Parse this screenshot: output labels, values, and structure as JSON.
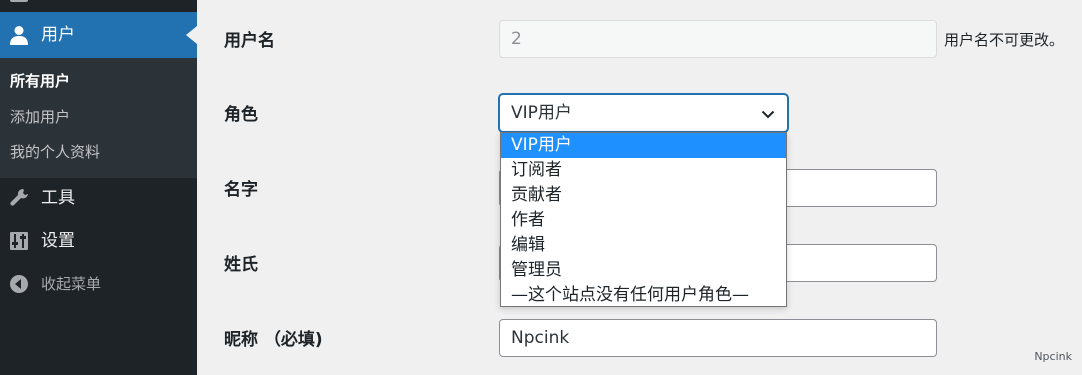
{
  "sidebar": {
    "active": {
      "label": "用户",
      "icon": "user-icon"
    },
    "submenu": [
      {
        "label": "所有用户",
        "current": true
      },
      {
        "label": "添加用户",
        "current": false
      },
      {
        "label": "我的个人资料",
        "current": false
      }
    ],
    "items": [
      {
        "label": "工具",
        "icon": "wrench-icon"
      },
      {
        "label": "设置",
        "icon": "settings-sliders-icon"
      },
      {
        "label": "收起菜单",
        "icon": "collapse-arrow-icon"
      }
    ]
  },
  "form": {
    "username": {
      "label": "用户名",
      "value": "2",
      "note": "用户名不可更改。"
    },
    "role": {
      "label": "角色",
      "selected": "VIP用户",
      "options": [
        "VIP用户",
        "订阅者",
        "贡献者",
        "作者",
        "编辑",
        "管理员",
        "—这个站点没有任何用户角色—"
      ]
    },
    "first_name": {
      "label": "名字",
      "value": ""
    },
    "last_name": {
      "label": "姓氏",
      "value": ""
    },
    "nickname": {
      "label": "昵称 （必填)",
      "value": "Npcink"
    }
  },
  "watermark": "Npcink",
  "colors": {
    "sidebar_bg": "#1d2327",
    "accent": "#2271b1",
    "highlight": "#1e90ff"
  }
}
